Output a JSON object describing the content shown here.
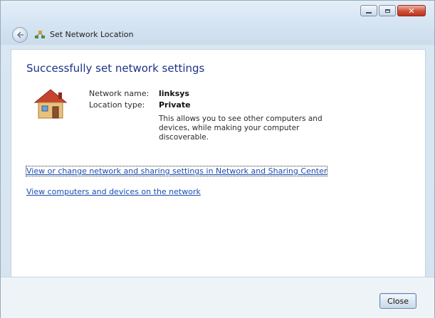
{
  "window": {
    "title": "Set Network Location",
    "caption_buttons": [
      "minimize",
      "maximize",
      "close"
    ]
  },
  "icons": {
    "back": "back-arrow-icon",
    "title": "network-location-icon",
    "location": "house-icon"
  },
  "main": {
    "heading": "Successfully set network settings",
    "network_name_label": "Network name:",
    "network_name_value": "linksys",
    "location_type_label": "Location type:",
    "location_type_value": "Private",
    "description": "This allows you to see other computers and devices, while making your computer discoverable.",
    "links": [
      "View or change network and sharing settings in Network and Sharing Center",
      "View computers and devices on the network"
    ]
  },
  "footer": {
    "close_label": "Close"
  },
  "colors": {
    "heading": "#1e3287",
    "link": "#1b4db3",
    "close_button": "#c8432c"
  }
}
